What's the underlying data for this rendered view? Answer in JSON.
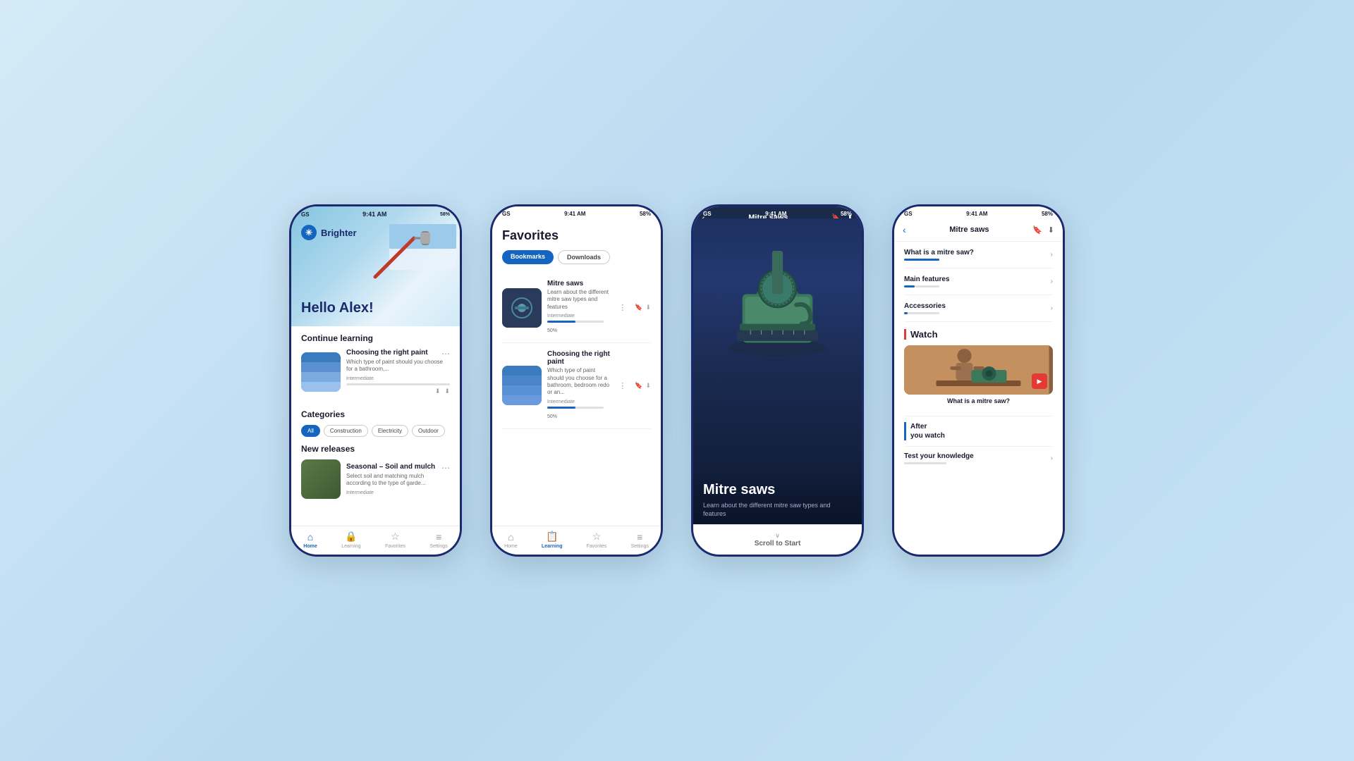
{
  "background": "#c8dff0",
  "phones": [
    {
      "id": "phone1",
      "type": "home",
      "status": {
        "left": "GS",
        "time": "9:41 AM",
        "battery": "58%"
      },
      "brand": {
        "icon": "✳",
        "name": "Brighter"
      },
      "greeting": "Hello Alex!",
      "continue_learning": {
        "label": "Continue learning",
        "item": {
          "title": "Choosing the right paint",
          "desc": "Which type of paint should you choose for a bathroom,...",
          "level": "Intermediate",
          "progress": 0
        }
      },
      "categories": {
        "label": "Categories",
        "items": [
          "All",
          "Construction",
          "Electricity",
          "Outdoor"
        ]
      },
      "new_releases": {
        "label": "New releases",
        "item": {
          "title": "Seasonal – Soil and mulch",
          "desc": "Select soil and matching mulch according to the type of garde...",
          "level": "Intermediate"
        }
      },
      "nav": {
        "items": [
          "Home",
          "Learning",
          "Favorites",
          "Settings"
        ],
        "active": "Home"
      }
    },
    {
      "id": "phone2",
      "type": "favorites",
      "status": {
        "left": "GS",
        "time": "9:41 AM",
        "battery": "58%"
      },
      "title": "Favorites",
      "tabs": [
        "Bookmarks",
        "Downloads"
      ],
      "active_tab": "Bookmarks",
      "items": [
        {
          "title": "Mitre saws",
          "desc": "Learn about the different mitre saw types and features",
          "level": "Intermediate",
          "progress": 50
        },
        {
          "title": "Choosing the right paint",
          "desc": "Which type of paint should you choose for a bathroom, bedroom redo or an...",
          "level": "Intermediate",
          "progress": 50
        }
      ],
      "nav": {
        "items": [
          "Home",
          "Learning",
          "Favorites",
          "Settings"
        ],
        "active": "Learning"
      }
    },
    {
      "id": "phone3",
      "type": "detail",
      "status": {
        "left": "GS",
        "time": "9:41 AM",
        "battery": "58%"
      },
      "back_label": "‹",
      "title": "Mitre saws",
      "main_title": "Mitre saws",
      "subtitle": "Learn about the different mitre saw types and features",
      "scroll_label": "Scroll to Start"
    },
    {
      "id": "phone4",
      "type": "toc",
      "status": {
        "left": "GS",
        "time": "9:41 AM",
        "battery": "58%"
      },
      "back_label": "‹",
      "title": "Mitre saws",
      "toc_items": [
        {
          "title": "What is a mitre saw?",
          "progress": 100
        },
        {
          "title": "Main features",
          "progress": 30
        },
        {
          "title": "Accessories",
          "progress": 10
        }
      ],
      "watch_section": {
        "label": "Watch",
        "video_title": "What is a mitre saw?"
      },
      "after_watch": {
        "label": "After\nyou watch"
      },
      "test_knowledge": {
        "title": "Test your knowledge"
      }
    }
  ]
}
